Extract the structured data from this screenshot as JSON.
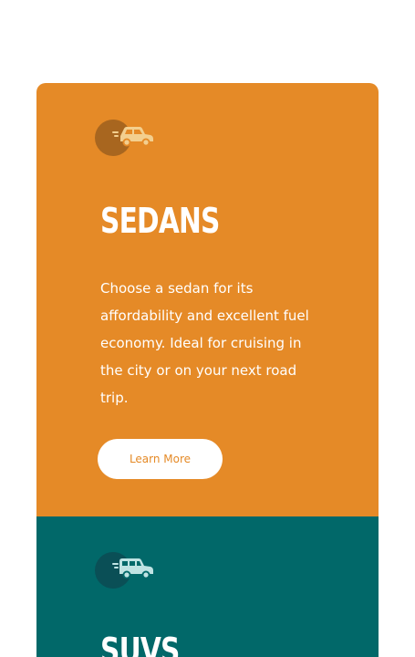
{
  "cards": [
    {
      "icon": "car-icon",
      "title": "SEDANS",
      "description": "Choose a sedan for its affordability and excellent fuel economy. Ideal for cruising in the city or on your next road trip.",
      "button_label": "Learn More"
    },
    {
      "icon": "suv-icon",
      "title": "SUVS"
    }
  ],
  "colors": {
    "orange": "#e58a27",
    "teal": "#016869",
    "icon_fill": "#f3cf8f",
    "suv_icon_fill": "#bfe3e3"
  }
}
